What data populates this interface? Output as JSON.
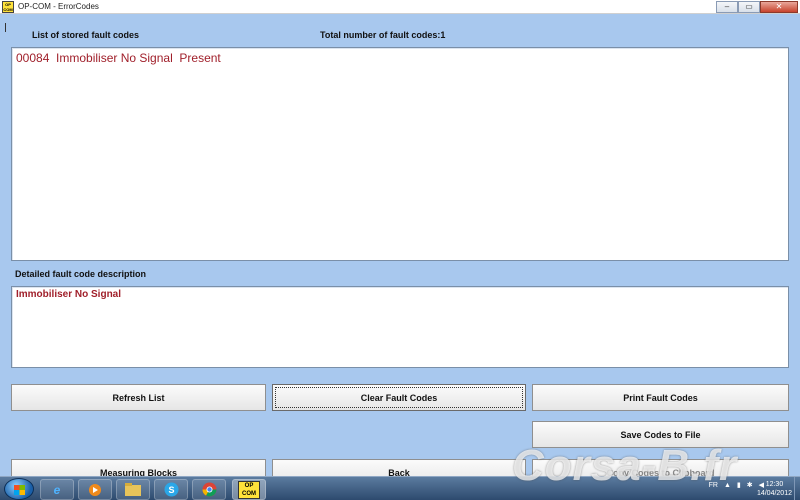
{
  "window": {
    "icon_text": "OP COM",
    "title": "OP-COM - ErrorCodes",
    "minimize": "–",
    "maximize": "▭",
    "close": "✕"
  },
  "stored_codes": {
    "heading": "List of stored fault codes",
    "total_label": "Total number of fault codes:1",
    "rows": [
      "00084  Immobiliser No Signal  Present"
    ]
  },
  "description": {
    "heading": "Detailed fault code description",
    "text": "Immobiliser No Signal"
  },
  "buttons": {
    "refresh": "Refresh List",
    "clear": "Clear Fault Codes",
    "print": "Print Fault Codes",
    "save": "Save Codes to File",
    "measuring": "Measuring Blocks",
    "back": "Back",
    "copy": "Copy Codes to Clipboard"
  },
  "taskbar": {
    "items": [
      "windows-start-icon",
      "internet-explorer-icon",
      "media-player-icon",
      "file-explorer-icon",
      "skype-icon",
      "chrome-icon",
      "opcom-icon"
    ],
    "opcom_label": "OP COM",
    "language": "FR",
    "time": "12:30",
    "date": "14/04/2012"
  },
  "watermark": "Corsa-B.fr"
}
